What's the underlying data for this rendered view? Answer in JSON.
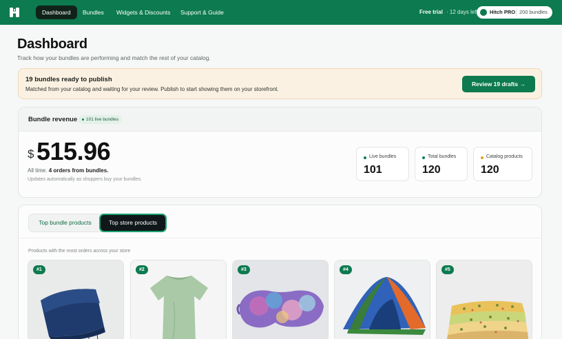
{
  "nav": {
    "tabs": [
      {
        "label": "Dashboard",
        "active": true
      },
      {
        "label": "Bundles"
      },
      {
        "label": "Widgets & Discounts"
      },
      {
        "label": "Support & Guide"
      }
    ],
    "trial_label": "Free trial",
    "trial_days": "· 12 days left",
    "plan_name": "Hitch PRO",
    "plan_count": "200 bundles"
  },
  "header": {
    "title": "Dashboard",
    "subtitle": "Track how your bundles are performing and match the rest of your catalog."
  },
  "banner": {
    "title": "19 bundles ready to publish",
    "text": "Matched from your catalog and waiting for your review. Publish to start showing them on your storefront.",
    "button": "Review 19 drafts →"
  },
  "revenue": {
    "title": "Bundle revenue",
    "badge": "101 live bundles",
    "currency": "$",
    "amount": "515.96",
    "meta_prefix": "All time.",
    "meta_bold": "4 orders from bundles.",
    "note": "Updates automatically as shoppers buy your bundles.",
    "stats": [
      {
        "label": "Live bundles",
        "value": "101",
        "dot": "#0d7a4f"
      },
      {
        "label": "Total bundles",
        "value": "120",
        "dot": "#0d7a4f"
      },
      {
        "label": "Catalog products",
        "value": "120",
        "dot": "#e0a020"
      }
    ]
  },
  "products": {
    "tabs": [
      "Top bundle products",
      "Top store products"
    ],
    "active_tab": "Top store products",
    "subtitle": "Products with the most orders across your store",
    "items": [
      {
        "rank": "#1",
        "image": "blue-knit-throw-blanket"
      },
      {
        "rank": "#2",
        "image": "sage-green-tshirt"
      },
      {
        "rank": "#3",
        "image": "tie-dye-sleep-mask"
      },
      {
        "rank": "#4",
        "image": "blue-orange-dome-tent"
      },
      {
        "rank": "#5",
        "image": "folded-floral-quilts"
      }
    ]
  },
  "colors": {
    "brand": "#0d7a4f",
    "banner_bg": "#fbf1e2",
    "active_dark": "#10231a"
  }
}
